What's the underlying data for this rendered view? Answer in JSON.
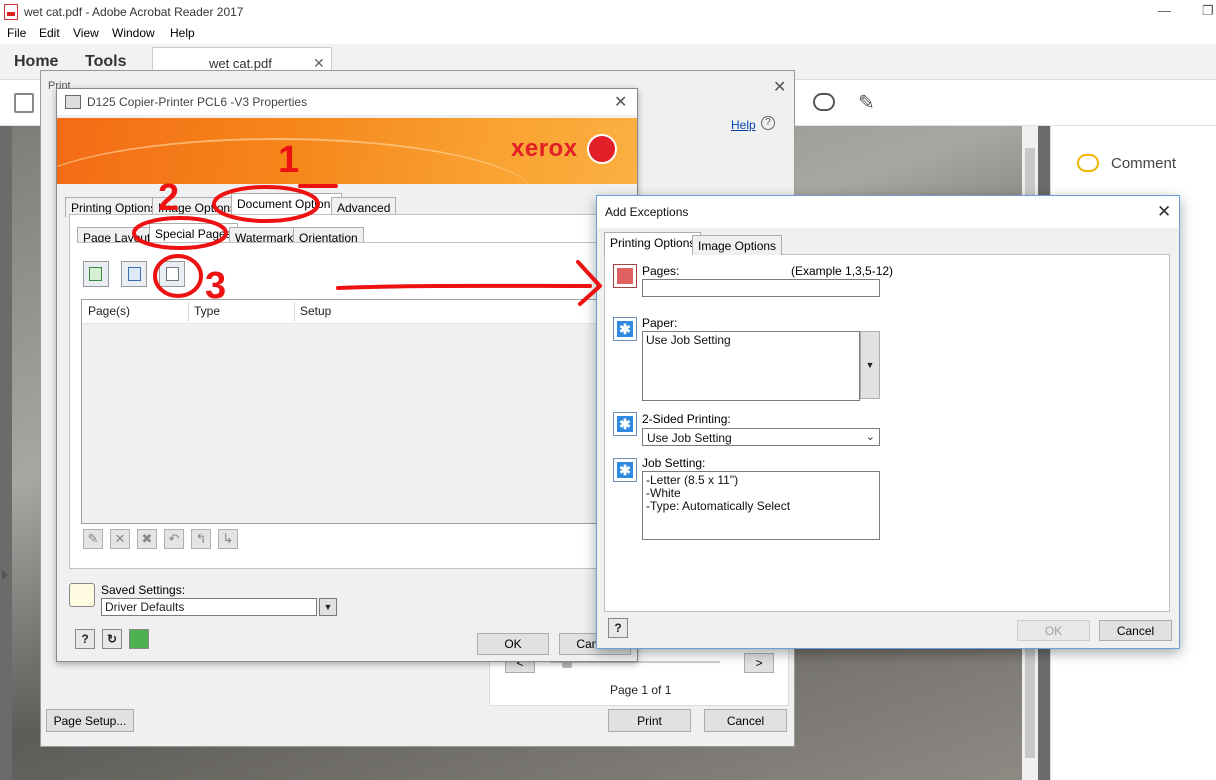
{
  "window": {
    "title": "wet cat.pdf - Adobe Acrobat Reader 2017",
    "menu": [
      "File",
      "Edit",
      "View",
      "Window",
      "Help"
    ],
    "tabs": {
      "home": "Home",
      "tools": "Tools",
      "document": "wet cat.pdf"
    }
  },
  "right_pane": {
    "comment": "Comment"
  },
  "print_dialog": {
    "title": "Print",
    "help": "Help",
    "page_of": "Page 1 of 1",
    "page_setup": "Page Setup...",
    "print": "Print",
    "cancel": "Cancel"
  },
  "properties_dialog": {
    "title": "D125 Copier-Printer PCL6 -V3 Properties",
    "brand": "xerox",
    "tabs": [
      "Printing Options",
      "Image Options",
      "Document Options",
      "Advanced"
    ],
    "subtabs": [
      "Page Layout",
      "Special Pages",
      "Watermark",
      "Orientation"
    ],
    "columns": [
      "Page(s)",
      "Type",
      "Setup"
    ],
    "saved_settings_label": "Saved Settings:",
    "saved_settings_value": "Driver Defaults",
    "ok": "OK",
    "cancel": "Cancel",
    "help_symbol": "?"
  },
  "add_exceptions": {
    "title": "Add Exceptions",
    "tabs": [
      "Printing Options",
      "Image Options"
    ],
    "pages_label": "Pages:",
    "pages_example": "(Example 1,3,5-12)",
    "pages_value": "",
    "paper_label": "Paper:",
    "paper_value": "Use Job Setting",
    "two_sided_label": "2-Sided Printing:",
    "two_sided_value": "Use Job Setting",
    "job_setting_label": "Job Setting:",
    "job_setting_lines": "-Letter (8.5 x 11\")\n-White\n-Type: Automatically Select",
    "ok": "OK",
    "cancel": "Cancel",
    "help_symbol": "?"
  },
  "annotations": {
    "marks": [
      "1",
      "2",
      "3"
    ]
  },
  "colors": {
    "accent_orange": "#f6861a",
    "xerox_red": "#e21e26",
    "annotation_red": "#ee1111",
    "link_blue": "#0645ad"
  }
}
